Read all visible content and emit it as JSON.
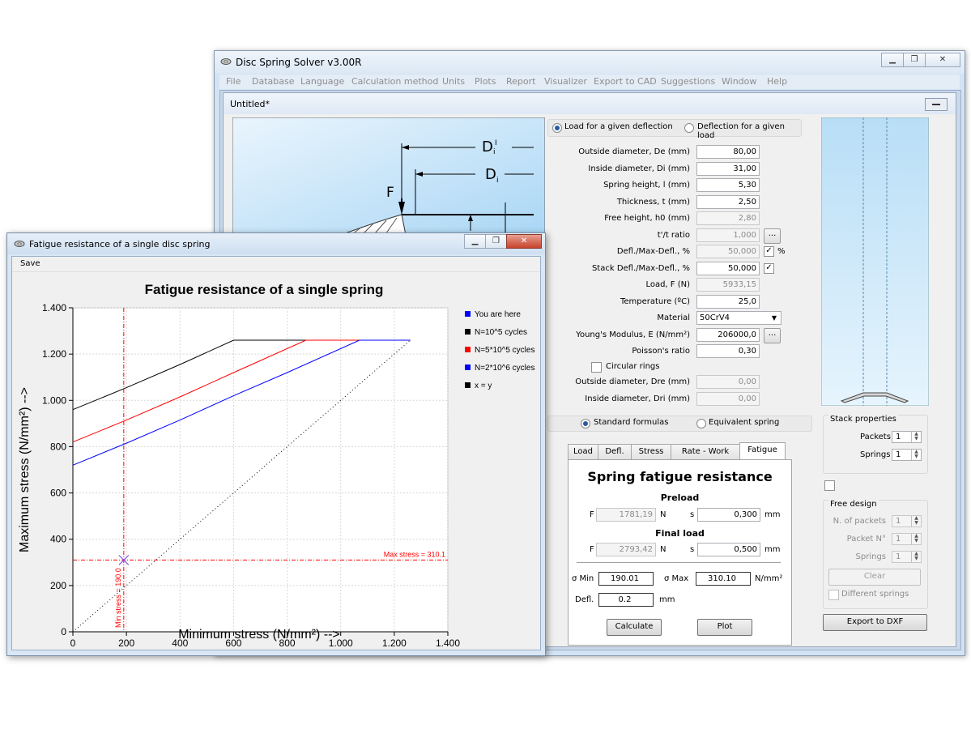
{
  "main_window": {
    "title": "Disc Spring Solver v3.00R",
    "menu": [
      "File",
      "Database",
      "Language",
      "Calculation method",
      "Units",
      "Plots",
      "Report",
      "Visualizer",
      "Export to CAD",
      "Suggestions",
      "Window",
      "Help"
    ],
    "child_title": "Untitled*",
    "diagram": {
      "label_di_prime_main": "D",
      "label_di_prime_sup": "i",
      "label_di_prime_sub": "I",
      "label_di_main": "D",
      "label_di_sub": "i",
      "label_f": "F"
    },
    "mode": {
      "option1": "Load for a given deflection",
      "option2": "Deflection for a given load",
      "selected": "option1"
    },
    "form": {
      "outside_diameter_label": "Outside diameter, De (mm)",
      "outside_diameter": "80,00",
      "inside_diameter_label": "Inside diameter, Di (mm)",
      "inside_diameter": "31,00",
      "spring_height_label": "Spring height, l (mm)",
      "spring_height": "5,30",
      "thickness_label": "Thickness, t (mm)",
      "thickness": "2,50",
      "free_height_label": "Free height, h0 (mm)",
      "free_height": "2,80",
      "tt_ratio_label": "t'/t ratio",
      "tt_ratio": "1,000",
      "defl_max_label": "Defl./Max-Defl., %",
      "defl_max": "50,000",
      "defl_max_unit": "%",
      "stack_defl_label": "Stack Defl./Max-Defl., %",
      "stack_defl": "50,000",
      "load_label": "Load, F (N)",
      "load": "5933,15",
      "temperature_label": "Temperature (ºC)",
      "temperature": "25,0",
      "material_label": "Material",
      "material": "50CrV4",
      "youngs_label": "Young's Modulus, E (N/mm²)",
      "youngs": "206000,0",
      "poisson_label": "Poisson's ratio",
      "poisson": "0,30",
      "circular_rings_label": "Circular rings",
      "outside_dre_label": "Outside diameter, Dre (mm)",
      "outside_dre": "0,00",
      "inside_dri_label": "Inside diameter, Dri (mm)",
      "inside_dri": "0,00",
      "dots": "..."
    },
    "formula": {
      "option1": "Standard formulas",
      "option2": "Equivalent spring"
    },
    "tabs": [
      "Load",
      "Defl.",
      "Stress",
      "Rate - Work",
      "Fatigue"
    ],
    "fatigue_panel": {
      "title": "Spring fatigue resistance",
      "preload_label": "Preload",
      "f_label": "F",
      "n_unit": "N",
      "s_label": "s",
      "mm_unit": "mm",
      "preload_f": "1781,19",
      "preload_s": "0,300",
      "final_label": "Final load",
      "final_f": "2793,42",
      "final_s": "0,500",
      "sigma_min_label": "σ Min",
      "sigma_min": "190.01",
      "sigma_max_label": "σ Max",
      "sigma_max": "310.10",
      "stress_unit": "N/mm²",
      "defl_label": "Defl.",
      "defl": "0.2",
      "defl_unit": "mm",
      "calculate": "Calculate",
      "plot": "Plot"
    },
    "stack": {
      "title": "Stack properties",
      "packets_label": "Packets",
      "packets": "1",
      "springs_label": "Springs",
      "springs": "1",
      "free_design_label": "Free design",
      "n_packets_label": "N. of packets",
      "n_packets": "1",
      "packet_no_label": "Packet N°",
      "packet_no": "1",
      "springs2_label": "Springs",
      "springs2": "1",
      "clear": "Clear",
      "different_springs": "Different springs",
      "export_dxf": "Export to DXF"
    }
  },
  "fatigue_window": {
    "title": "Fatigue resistance of a single disc spring",
    "menu_save": "Save",
    "legend": [
      {
        "name": "You are here",
        "color": "#0000ff"
      },
      {
        "name": "N=10^5 cycles",
        "color": "#000000"
      },
      {
        "name": "N=5*10^5 cycles",
        "color": "#ff0000"
      },
      {
        "name": "N=2*10^6 cycles",
        "color": "#0000ff"
      },
      {
        "name": "x = y",
        "color": "#000000"
      }
    ],
    "max_stress_annotation": "Max stress = 310.1",
    "min_stress_annotation": "Min stress = 190.0"
  },
  "chart_data": {
    "type": "line",
    "title": "Fatigue resistance of a single spring",
    "xlabel": "Minimum stress (N/mm²) -->",
    "ylabel": "Maximum stress (N/mm²) -->",
    "xlim": [
      0,
      1400
    ],
    "ylim": [
      0,
      1400
    ],
    "xticks": [
      "0",
      "200",
      "400",
      "600",
      "800",
      "1.000",
      "1.200",
      "1.400"
    ],
    "yticks": [
      "0",
      "200",
      "400",
      "600",
      "800",
      "1.000",
      "1.200",
      "1.400"
    ],
    "grid": true,
    "legend_position": "right",
    "series": [
      {
        "name": "N=10^5 cycles",
        "color": "#000000",
        "style": "solid",
        "x": [
          0,
          200,
          400,
          600,
          1260
        ],
        "y": [
          960,
          1055,
          1155,
          1260,
          1260
        ]
      },
      {
        "name": "N=5*10^5 cycles",
        "color": "#ff0000",
        "style": "solid",
        "x": [
          0,
          200,
          400,
          600,
          870,
          1260
        ],
        "y": [
          820,
          915,
          1015,
          1120,
          1260,
          1260
        ]
      },
      {
        "name": "N=2*10^6 cycles",
        "color": "#0000ff",
        "style": "solid",
        "x": [
          0,
          200,
          400,
          600,
          800,
          1070,
          1260
        ],
        "y": [
          720,
          815,
          915,
          1020,
          1120,
          1260,
          1260
        ]
      },
      {
        "name": "x = y",
        "color": "#000000",
        "style": "dotted",
        "x": [
          0,
          1260
        ],
        "y": [
          0,
          1260
        ]
      }
    ],
    "point": {
      "name": "You are here",
      "x": 190.0,
      "y": 310.1,
      "color": "#0000ff"
    },
    "reference_lines": {
      "x": 190.0,
      "y": 310.1,
      "color": "#ff0000"
    }
  }
}
